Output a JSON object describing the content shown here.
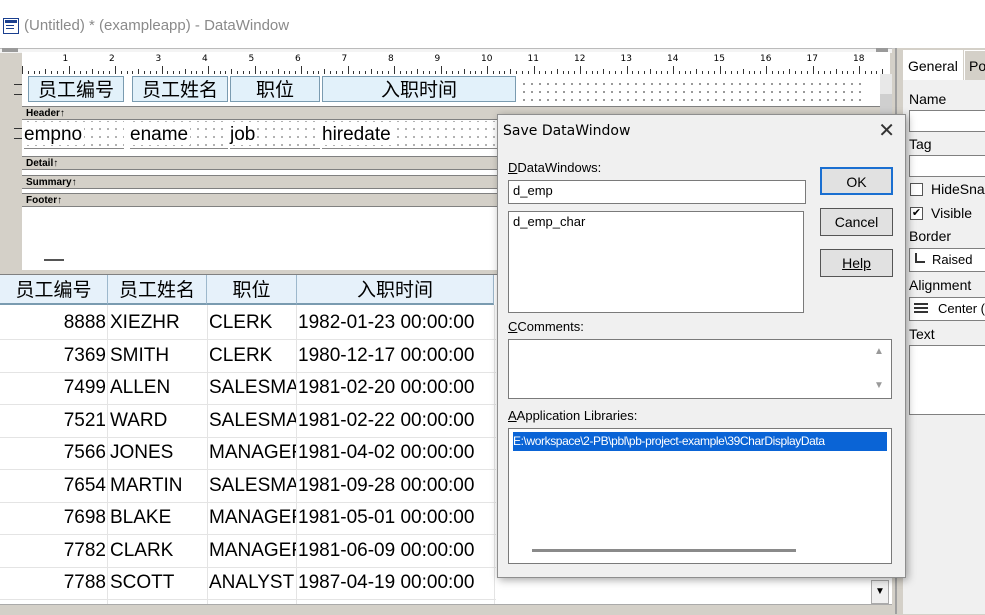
{
  "window": {
    "title": "(Untitled) * (exampleapp) - DataWindow"
  },
  "ruler": {
    "numbers": [
      "1",
      "2",
      "3",
      "4",
      "5",
      "6",
      "7",
      "8",
      "9",
      "10",
      "11",
      "12",
      "13",
      "14",
      "15",
      "16",
      "17",
      "18"
    ]
  },
  "design": {
    "headers": [
      "员工编号",
      "员工姓名",
      "职位",
      "入职时间"
    ],
    "fields": [
      "empno",
      "ename",
      "job",
      "hiredate"
    ],
    "bands": [
      "Header↑",
      "Detail↑",
      "Summary↑",
      "Footer↑"
    ]
  },
  "preview": {
    "columns": [
      "员工编号",
      "员工姓名",
      "职位",
      "入职时间"
    ],
    "rows": [
      [
        "8888",
        "XIEZHR",
        "CLERK",
        "1982-01-23 00:00:00"
      ],
      [
        "7369",
        "SMITH",
        "CLERK",
        "1980-12-17 00:00:00"
      ],
      [
        "7499",
        "ALLEN",
        "SALESMAN",
        "1981-02-20 00:00:00"
      ],
      [
        "7521",
        "WARD",
        "SALESMAN",
        "1981-02-22 00:00:00"
      ],
      [
        "7566",
        "JONES",
        "MANAGER",
        "1981-04-02 00:00:00"
      ],
      [
        "7654",
        "MARTIN",
        "SALESMAN",
        "1981-09-28 00:00:00"
      ],
      [
        "7698",
        "BLAKE",
        "MANAGER",
        "1981-05-01 00:00:00"
      ],
      [
        "7782",
        "CLARK",
        "MANAGER",
        "1981-06-09 00:00:00"
      ],
      [
        "7788",
        "SCOTT",
        "ANALYST",
        "1987-04-19 00:00:00"
      ]
    ]
  },
  "properties": {
    "tabs": [
      "General",
      "Po"
    ],
    "name_label": "Name",
    "tag_label": "Tag",
    "hidesnap_label": "HideSnal",
    "visible_label": "Visible",
    "border_label": "Border",
    "border_value": "Raised",
    "alignment_label": "Alignment",
    "alignment_value": "Center (",
    "text_label": "Text"
  },
  "dialog": {
    "title": "Save DataWindow",
    "datawindows_label": "DataWindows:",
    "datawindow_name": "d_emp",
    "datawindow_list": [
      "d_emp_char"
    ],
    "comments_label": "Comments:",
    "libraries_label": "Application Libraries:",
    "library_selected": "E:\\workspace\\2-PB\\pbl\\pb-project-example\\39CharDisplayData",
    "ok_label": "OK",
    "cancel_label": "Cancel",
    "help_label": "Help"
  }
}
